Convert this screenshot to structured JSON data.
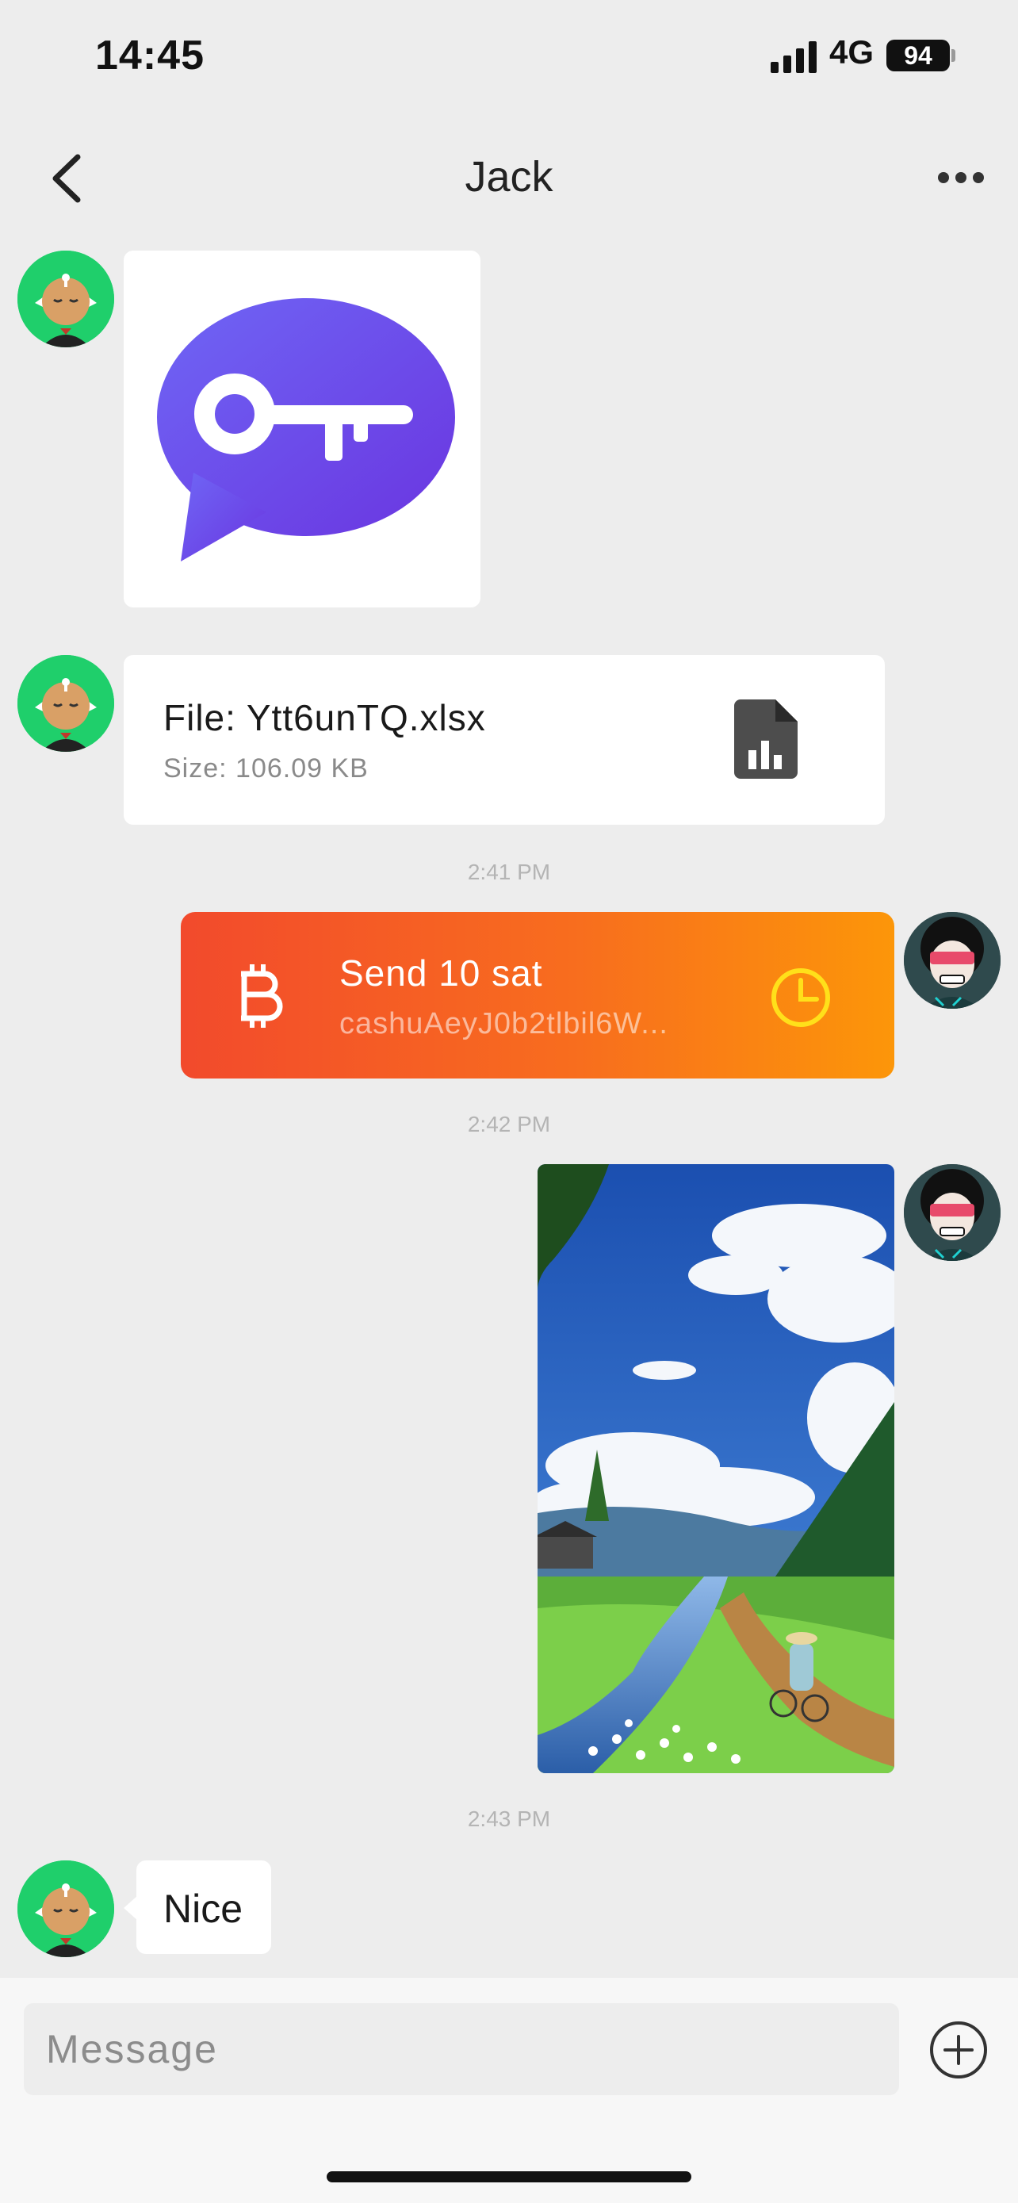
{
  "status_bar": {
    "time": "14:45",
    "network": "4G",
    "battery": "94"
  },
  "nav": {
    "title": "Jack"
  },
  "messages": {
    "file": {
      "name": "File: Ytt6unTQ.xlsx",
      "size": "Size: 106.09 KB"
    },
    "ts1": "2:41 PM",
    "ecash": {
      "title": "Send 10 sat",
      "token": "cashuAeyJ0b2tlbil6W..."
    },
    "ts2": "2:42 PM",
    "ts3": "2:43 PM",
    "text": "Nice"
  },
  "input": {
    "placeholder": "Message"
  },
  "colors": {
    "background": "#ededed",
    "bubble": "#ffffff",
    "ecash_start": "#f24a2c",
    "ecash_end": "#fc9609",
    "avatar_green": "#1fcf6b",
    "app_icon_purple": "#6a4ff0"
  },
  "icons": {
    "back": "chevron-left-icon",
    "more": "ellipsis-icon",
    "file": "spreadsheet-file-icon",
    "bitcoin": "bitcoin-icon",
    "pending": "clock-icon",
    "add": "plus-circle-icon"
  }
}
